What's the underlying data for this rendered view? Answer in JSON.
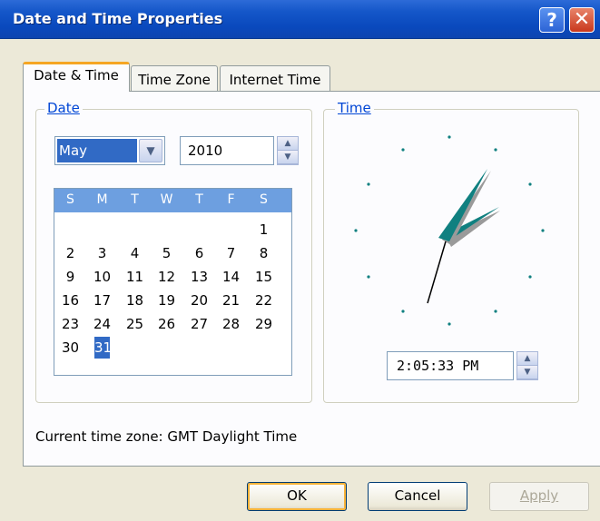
{
  "window": {
    "title": "Date and Time Properties",
    "help_glyph": "?",
    "close_glyph": "✕"
  },
  "tabs": [
    {
      "label": "Date & Time",
      "active": true
    },
    {
      "label": "Time Zone",
      "active": false
    },
    {
      "label": "Internet Time",
      "active": false
    }
  ],
  "date_group": {
    "legend": "Date",
    "month": "May",
    "year": "2010",
    "calendar": {
      "weekday_headers": [
        "S",
        "M",
        "T",
        "W",
        "T",
        "F",
        "S"
      ],
      "weeks": [
        [
          "",
          "",
          "",
          "",
          "",
          "",
          "1"
        ],
        [
          "2",
          "3",
          "4",
          "5",
          "6",
          "7",
          "8"
        ],
        [
          "9",
          "10",
          "11",
          "12",
          "13",
          "14",
          "15"
        ],
        [
          "16",
          "17",
          "18",
          "19",
          "20",
          "21",
          "22"
        ],
        [
          "23",
          "24",
          "25",
          "26",
          "27",
          "28",
          "29"
        ],
        [
          "30",
          "31",
          "",
          "",
          "",
          "",
          ""
        ]
      ],
      "selected_day": "31"
    }
  },
  "time_group": {
    "legend": "Time",
    "time_value": "2:05:33 PM"
  },
  "current_time_zone": "Current time zone:  GMT Daylight Time",
  "buttons": {
    "ok": "OK",
    "cancel": "Cancel",
    "apply": "Apply"
  },
  "colors": {
    "title_bar": "#0a49bd",
    "selection": "#316ac5",
    "calendar_header": "#6d9fe0",
    "clock_hands": "#108080",
    "group_legend": "#0046d5"
  }
}
